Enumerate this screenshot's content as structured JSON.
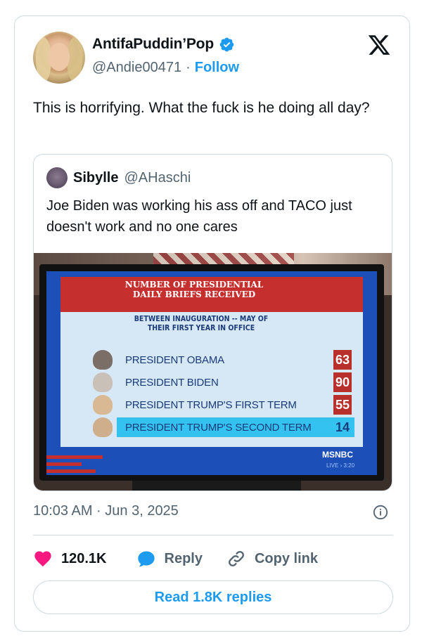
{
  "tweet": {
    "author": {
      "display_name": "AntifaPuddin’Pop",
      "handle": "@Andie00471",
      "follow_label": "Follow",
      "separator": "·"
    },
    "text": "This is horrifying. What the fuck is he doing all day?",
    "timestamp": "10:03 AM · Jun 3, 2025",
    "likes_count": "120.1K",
    "reply_label": "Reply",
    "copy_link_label": "Copy link",
    "read_replies_label": "Read 1.8K replies"
  },
  "quoted_tweet": {
    "display_name": "Sibylle",
    "handle": "@AHaschi",
    "text": "Joe Biden was working his ass off and TACO just doesn't work and no one cares"
  },
  "tv_graphic": {
    "title_line1": "NUMBER OF PRESIDENTIAL",
    "title_line2": "DAILY BRIEFS RECEIVED",
    "subtitle_line1": "BETWEEN INAUGURATION -- MAY OF",
    "subtitle_line2": "THEIR FIRST YEAR IN OFFICE",
    "rows": [
      {
        "label": "PRESIDENT OBAMA",
        "value": "63"
      },
      {
        "label": "PRESIDENT BIDEN",
        "value": "90"
      },
      {
        "label": "PRESIDENT TRUMP'S FIRST TERM",
        "value": "55"
      },
      {
        "label": "PRESIDENT TRUMP'S SECOND TERM",
        "value": "14"
      }
    ],
    "network": "MSNBC",
    "live_text": "LIVE › 3:20"
  },
  "colors": {
    "accent": "#1d9bf0",
    "like": "#f91880",
    "reply_icon": "#1d9bf0",
    "text_secondary": "#536471",
    "border": "#cfd9de"
  },
  "icons": [
    "verified-badge-icon",
    "x-logo-icon",
    "info-icon",
    "heart-icon",
    "reply-bubble-icon",
    "link-icon"
  ]
}
